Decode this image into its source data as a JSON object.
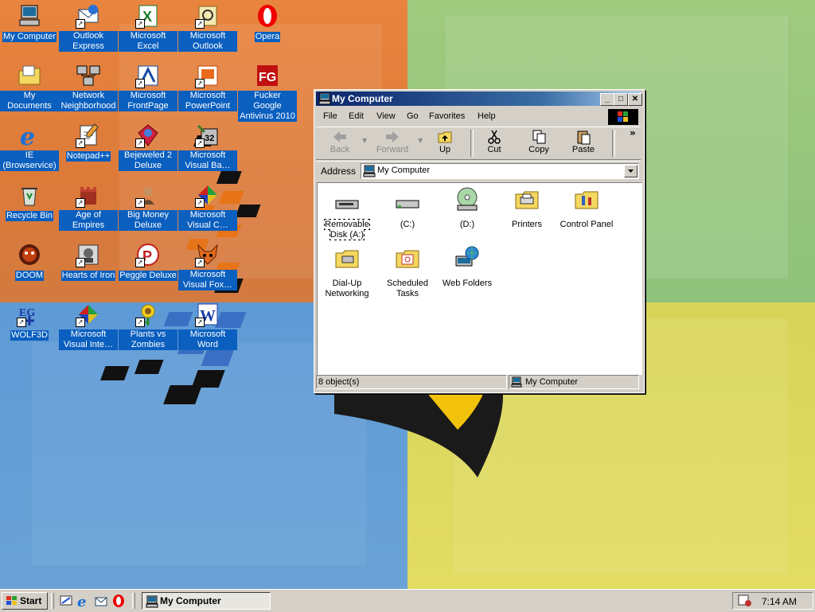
{
  "desktop_icons": [
    {
      "label": "My Computer",
      "icon": "computer-icon"
    },
    {
      "label": "Outlook Express",
      "icon": "outlook-express-icon"
    },
    {
      "label": "Microsoft Excel",
      "icon": "excel-icon"
    },
    {
      "label": "Microsoft Outlook",
      "icon": "outlook-icon"
    },
    {
      "label": "Opera",
      "icon": "opera-icon"
    },
    {
      "label": "My Documents",
      "icon": "documents-folder-icon"
    },
    {
      "label": "Network Neighborhood",
      "icon": "network-icon"
    },
    {
      "label": "Microsoft FrontPage",
      "icon": "frontpage-icon"
    },
    {
      "label": "Microsoft PowerPoint",
      "icon": "powerpoint-icon"
    },
    {
      "label": "Fucker Google Antivirus 2010",
      "icon": "antivirus-icon"
    },
    {
      "label": "IE (Browservice)",
      "icon": "ie-icon"
    },
    {
      "label": "Notepad++",
      "icon": "notepad-icon"
    },
    {
      "label": "Bejeweled 2 Deluxe",
      "icon": "bejeweled-icon"
    },
    {
      "label": "Microsoft Visual Ba…",
      "icon": "visual-basic-icon"
    },
    {
      "label": "Recycle Bin",
      "icon": "recycle-bin-icon"
    },
    {
      "label": "Age of Empires",
      "icon": "age-of-empires-icon"
    },
    {
      "label": "Big Money Deluxe",
      "icon": "big-money-icon"
    },
    {
      "label": "Microsoft Visual C…",
      "icon": "visual-c-icon"
    },
    {
      "label": "DOOM",
      "icon": "doom-icon"
    },
    {
      "label": "Hearts of Iron",
      "icon": "hearts-of-iron-icon"
    },
    {
      "label": "Peggle Deluxe",
      "icon": "peggle-icon"
    },
    {
      "label": "Microsoft Visual Fox…",
      "icon": "visual-foxpro-icon"
    },
    {
      "label": "WOLF3D",
      "icon": "wolf3d-icon"
    },
    {
      "label": "Microsoft Visual Inte…",
      "icon": "visual-interdev-icon"
    },
    {
      "label": "Plants vs Zombies",
      "icon": "plants-vs-zombies-icon"
    },
    {
      "label": "Microsoft Word",
      "icon": "word-icon"
    }
  ],
  "window": {
    "title": "My Computer",
    "menu": [
      "File",
      "Edit",
      "View",
      "Go",
      "Favorites",
      "Help"
    ],
    "toolbar": {
      "back": "Back",
      "forward": "Forward",
      "up": "Up",
      "cut": "Cut",
      "copy": "Copy",
      "paste": "Paste",
      "more": "»"
    },
    "address_label": "Address",
    "address_value": "My Computer",
    "items": [
      {
        "label": "Removable Disk (A:)",
        "icon": "floppy-drive-icon"
      },
      {
        "label": "(C:)",
        "icon": "hard-drive-icon"
      },
      {
        "label": "(D:)",
        "icon": "cd-drive-icon"
      },
      {
        "label": "Printers",
        "icon": "printers-folder-icon"
      },
      {
        "label": "Control Panel",
        "icon": "control-panel-icon"
      },
      {
        "label": "Dial-Up Networking",
        "icon": "dialup-networking-icon"
      },
      {
        "label": "Scheduled Tasks",
        "icon": "scheduled-tasks-icon"
      },
      {
        "label": "Web Folders",
        "icon": "web-folders-icon"
      }
    ],
    "status_count": "8 object(s)",
    "status_location": "My Computer"
  },
  "taskbar": {
    "start_label": "Start",
    "task_label": "My Computer",
    "clock": "7:14 AM"
  }
}
